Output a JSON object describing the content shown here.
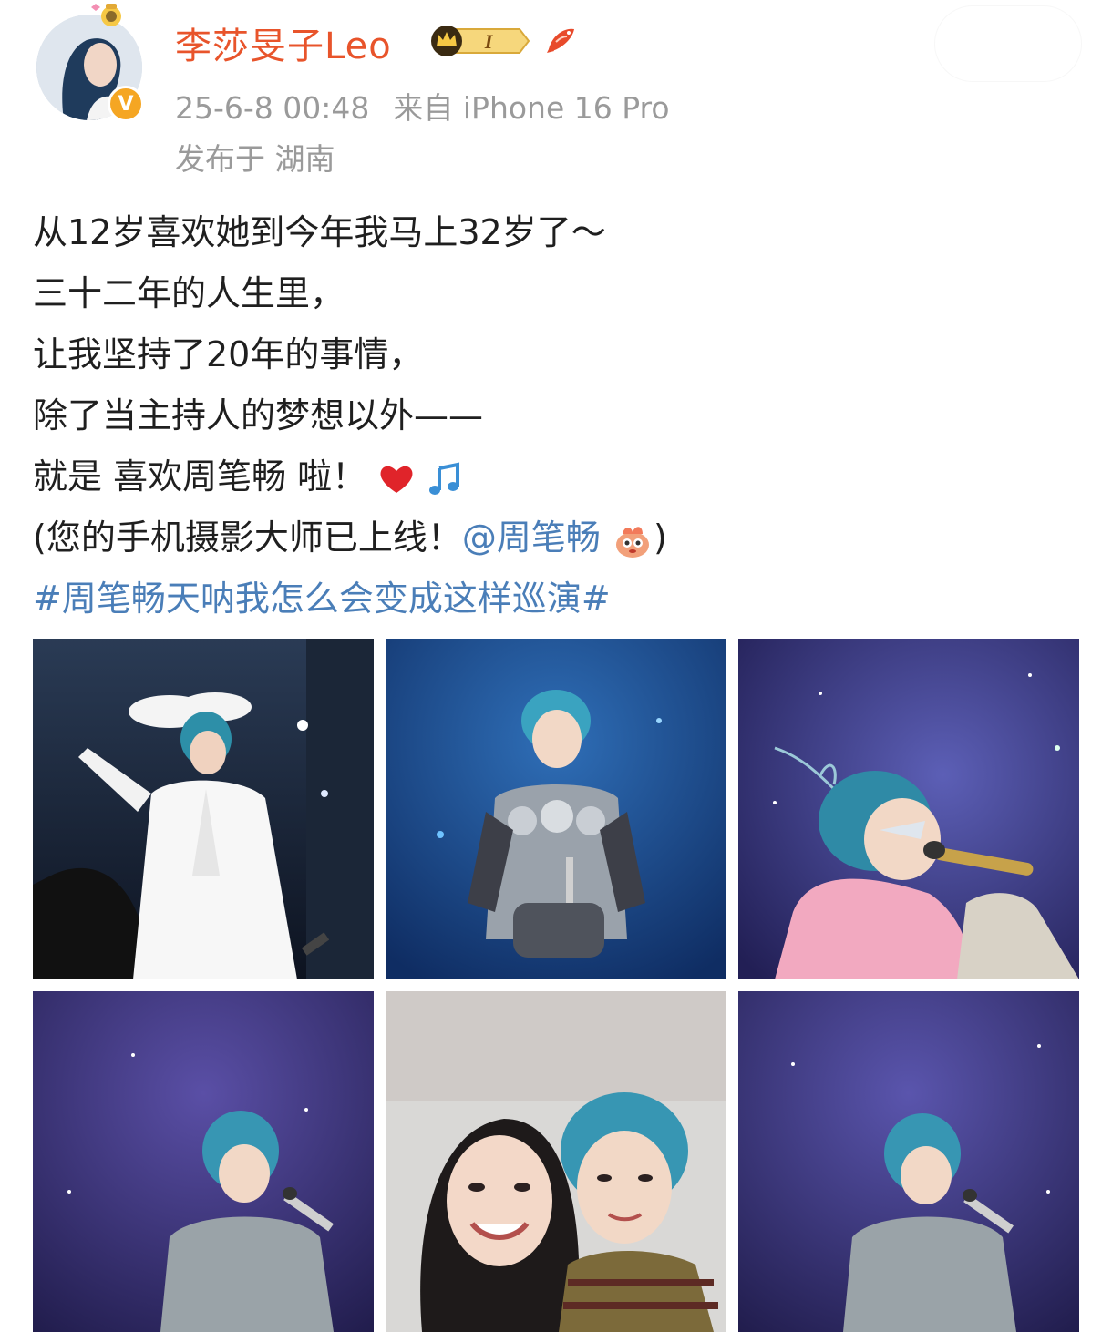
{
  "post": {
    "username": "李莎旻子Leo",
    "vip_level": "I",
    "timestamp": "25-6-8 00:48",
    "source": "来自 iPhone 16 Pro",
    "location": "发布于 湖南",
    "body_lines": [
      "从12岁喜欢她到今年我马上32岁了～",
      "三十二年的人生里，",
      "让我坚持了20年的事情，",
      "除了当主持人的梦想以外——",
      "就是 喜欢周笔畅 啦！"
    ],
    "paren_line_prefix": "(您的手机摄影大师已上线！",
    "mention": "@周笔畅",
    "paren_line_suffix": ")",
    "hashtag": "#周笔畅天呐我怎么会变成这样巡演#"
  },
  "icons": {
    "verified": "verified-v-icon",
    "vip": "crown-vip-badge-icon",
    "koi": "koi-fish-icon",
    "heart": "red-heart-emoji",
    "music": "music-note-emoji",
    "sticker": "cute-creature-sticker"
  },
  "colors": {
    "username": "#e8542b",
    "link": "#4a7eb8",
    "meta": "#9a9a9a",
    "verified": "#f5a623"
  },
  "verified_label": "V",
  "photos": [
    {
      "name": "photo-white-suit-stage"
    },
    {
      "name": "photo-silver-armor-stage"
    },
    {
      "name": "photo-singing-pink-fur"
    },
    {
      "name": "photo-gray-shirt-singing"
    },
    {
      "name": "photo-selfie-two-women"
    },
    {
      "name": "photo-gray-shirt-singing-2"
    }
  ]
}
